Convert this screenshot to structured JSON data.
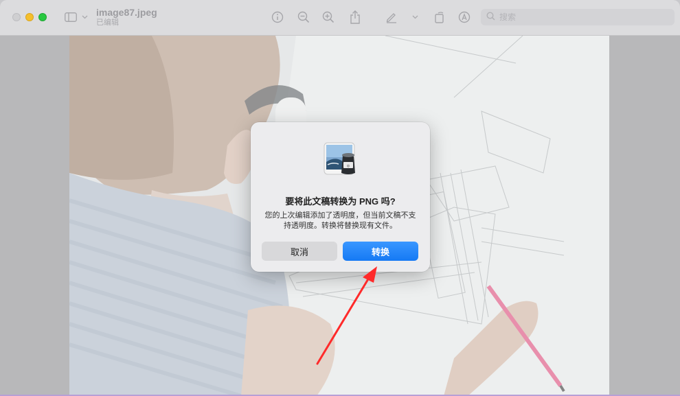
{
  "window": {
    "file_name": "image87.jpeg",
    "file_status": "已编辑"
  },
  "search": {
    "placeholder": "搜索"
  },
  "dialog": {
    "title": "要将此文稿转换为 PNG 吗?",
    "message": "您的上次编辑添加了透明度，但当前文稿不支持透明度。转换将替换现有文件。",
    "cancel_label": "取消",
    "convert_label": "转换"
  },
  "annotation": {
    "arrow_color": "#ff2a2a"
  },
  "colors": {
    "accent": "#1579f4",
    "close": "#cfcfd1",
    "minimize": "#f5bf2c",
    "maximize": "#28c840"
  },
  "icons": [
    "sidebar-icon",
    "chevron-down-icon",
    "info-icon",
    "zoom-out-icon",
    "zoom-in-icon",
    "share-icon",
    "markup-pen-icon",
    "rotate-icon",
    "markup-icon",
    "search-icon",
    "preview-app-icon"
  ]
}
